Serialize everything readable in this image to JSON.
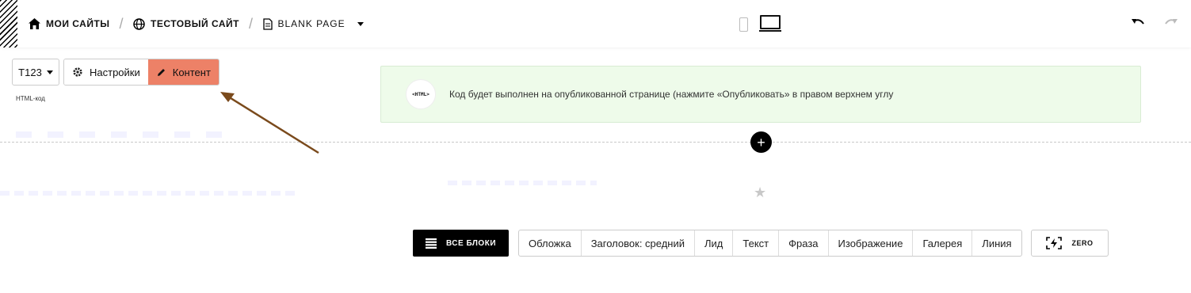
{
  "header": {
    "breadcrumbs": [
      {
        "label": "МОИ САЙТЫ"
      },
      {
        "label": "ТЕСТОВЫЙ САЙТ"
      },
      {
        "label": "BLANK PAGE"
      }
    ],
    "separator": "/"
  },
  "toolbar": {
    "block_code": "T123",
    "settings_label": "Настройки",
    "content_label": "Контент",
    "block_type_label": "HTML-код",
    "active_color": "#ed8167"
  },
  "notice": {
    "icon_text": "<HTML>",
    "text": "Код будет выполнен на опубликованной странице (нажмите «Опубликовать» в правом верхнем углу"
  },
  "add_block": {
    "plus": "+"
  },
  "library": {
    "all_blocks_label": "ВСЕ БЛОКИ",
    "categories": [
      "Обложка",
      "Заголовок: средний",
      "Лид",
      "Текст",
      "Фраза",
      "Изображение",
      "Галерея",
      "Линия"
    ],
    "zero_label": "ZERO"
  },
  "annotation": {
    "arrow_color": "#7a4a1c"
  }
}
